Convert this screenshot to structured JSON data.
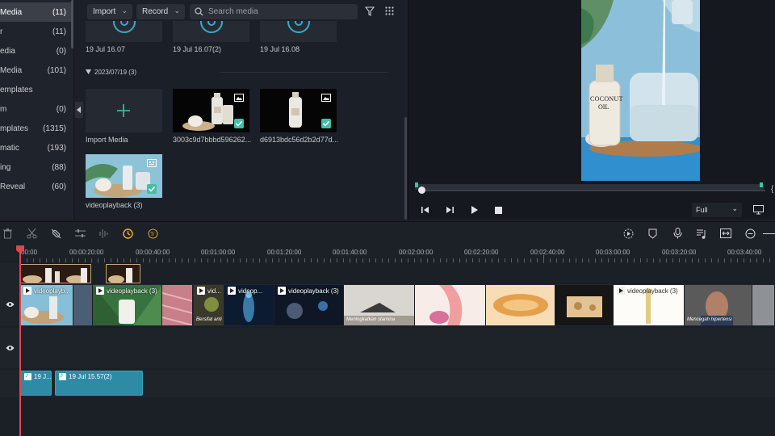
{
  "sidebar": {
    "items": [
      {
        "label": "Media",
        "count": "(11)",
        "active": true
      },
      {
        "label": "r",
        "count": "(11)"
      },
      {
        "label": "edia",
        "count": "(0)"
      },
      {
        "label": "Media",
        "count": "(101)"
      },
      {
        "label": "emplates",
        "count": ""
      },
      {
        "label": "m",
        "count": "(0)"
      },
      {
        "label": "mplates",
        "count": "(1315)"
      },
      {
        "label": "matic",
        "count": "(193)"
      },
      {
        "label": "ing",
        "count": "(88)"
      },
      {
        "label": "Reveal",
        "count": "(60)"
      },
      {
        "label": "",
        "count": ""
      }
    ]
  },
  "media": {
    "import_label": "Import",
    "record_label": "Record",
    "search_placeholder": "Search media",
    "top_captions": [
      "19 Jul 16.07",
      "19 Jul 16.07(2)",
      "19 Jul 16.08"
    ],
    "folder_label": "2023/07/19 (3)",
    "import_media_label": "Import Media",
    "items": [
      "3003c9d7bbbd596262...",
      "d6913bdc56d2b2d77d...",
      "videoplayback (3)"
    ]
  },
  "preview": {
    "zoom_label": "Full",
    "image_text": {
      "brand": "COCONUT",
      "sub": "OIL"
    }
  },
  "timeline": {
    "ruler_labels": [
      "00:00",
      "00:00:20:00",
      "00:00:40:00",
      "00:01:00:00",
      "00:01:20:00",
      "00:01:40:00",
      "00:02:00:00",
      "00:02:20:00",
      "00:02:40:00",
      "00:03:00:00",
      "00:03:20:00",
      "00:03:40:00"
    ],
    "clip_titles": [
      "videoplayb...",
      "videoplayback (3)",
      "vid...",
      "videop...",
      "videoplayback (3)",
      "videoplayback (3)"
    ],
    "subtitles": [
      "Bersifat anti",
      "Meningkatkan stamina",
      "Mencegah hipertensi"
    ],
    "audio_clips": [
      "19 J...",
      "19 Jul 15.57(2)"
    ]
  },
  "colors": {
    "accent": "#3fc1a5",
    "playhead": "#e0474c",
    "audio": "#2d8ba5",
    "marker": "#f0b429"
  }
}
